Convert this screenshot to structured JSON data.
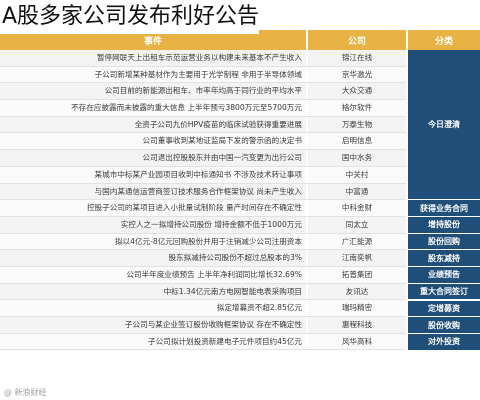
{
  "headline": "A股多家公司发布利好公告",
  "table": {
    "header_event": "事件",
    "header_company": "公司",
    "header_category": "分类",
    "rows": [
      {
        "company": "锦江在线",
        "event": "暂停网联天上出租车示范运营业务以构建未来基本不产生收入"
      },
      {
        "company": "京华激光",
        "event": "子公司新增某种基材作为主要用于光学制程 非用于半导体领域"
      },
      {
        "company": "大众交通",
        "event": "公司目前的新能源出租车、市率年均高于同行业的平均水平"
      },
      {
        "company": "格尔软件",
        "event": "不存在应披露而未披露的重大信息 上半年预亏3800万元至5700万元"
      },
      {
        "company": "万泰生物",
        "event": "全资子公司九价HPV疫苗的临床试验获得重要进展"
      },
      {
        "company": "启明信息",
        "event": "公司董事收到某地证监局下发的警示函的决定书"
      },
      {
        "company": "国中水务",
        "event": "公司退出控股股东并由中国一汽变更为出行公司"
      },
      {
        "company": "中关村",
        "event": "某城市中标某产业园项目收到中标通知书 不涉及技术转让事项"
      },
      {
        "company": "中富通",
        "event": "与国内某通信运营商签订技术服务合作框架协议 尚未产生收入"
      },
      {
        "company": "中科金财",
        "event": "控股子公司的某项目进入小批量试制阶段 量产时间存在不确定性"
      },
      {
        "company": "同太立",
        "event": "实控人之一拟增持公司股份 增持金额不低于1000万元"
      },
      {
        "company": "广汇能源",
        "event": "拟以4亿元-8亿元回购股份并用于注销减少公司注册资本"
      },
      {
        "company": "江南奕帆",
        "event": "股东拟减持公司股份不超过总股本的3%"
      },
      {
        "company": "拓普集团",
        "event": "公司半年度业绩预告 上半年净利润同比增长32.69%"
      },
      {
        "company": "友讯达",
        "event": "中标1.34亿元南方电网智能电表采购项目"
      },
      {
        "company": "瑞玛精密",
        "event": "拟定增募资不超2.85亿元"
      },
      {
        "company": "惠程科技",
        "event": "子公司与某企业签订股份收购框架协议 存在不确定性"
      },
      {
        "company": "风华高科",
        "event": "子公司拟计划投资新建电子元件项目约45亿元"
      }
    ],
    "categories": [
      {
        "label": "今日澄清",
        "span": 9
      },
      {
        "label": "获得业务合同",
        "span": 1
      },
      {
        "label": "增持股份",
        "span": 1
      },
      {
        "label": "股份回购",
        "span": 1
      },
      {
        "label": "股东减持",
        "span": 1
      },
      {
        "label": "业绩预告",
        "span": 1
      },
      {
        "label": "重大合同签订",
        "span": 1
      },
      {
        "label": "定增募资",
        "span": 1
      },
      {
        "label": "股份收购",
        "span": 1
      },
      {
        "label": "对外投资",
        "span": 1
      }
    ]
  },
  "watermark": "@ 新浪财经"
}
